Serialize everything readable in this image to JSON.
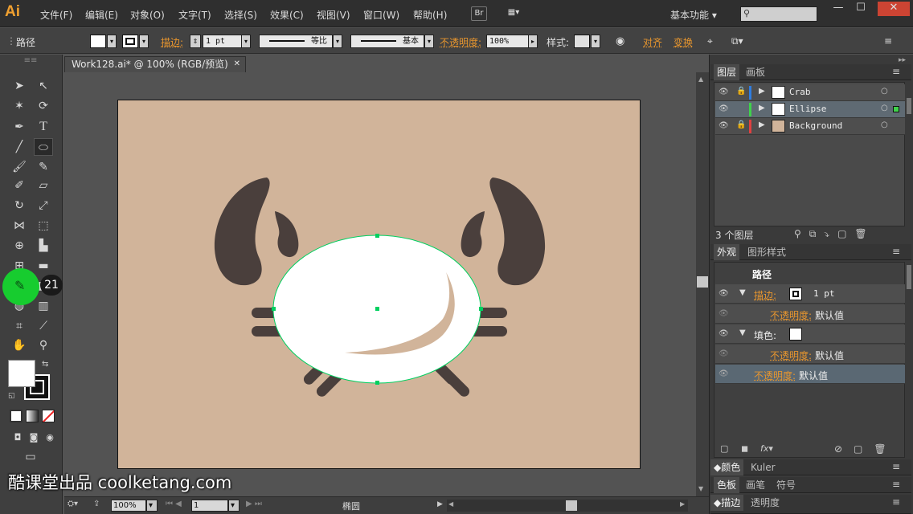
{
  "app": {
    "logo": "Ai",
    "menus": [
      "文件(F)",
      "编辑(E)",
      "对象(O)",
      "文字(T)",
      "选择(S)",
      "效果(C)",
      "视图(V)",
      "窗口(W)",
      "帮助(H)"
    ],
    "bridge_label": "Br",
    "workspace": "基本功能",
    "window_buttons": [
      "—",
      "☐",
      "✕"
    ]
  },
  "control_bar": {
    "object_type": "路径",
    "stroke_label": "描边:",
    "stroke_weight": "1 pt",
    "profile_label": "等比",
    "brush_label": "基本",
    "opacity_label": "不透明度:",
    "opacity_value": "100%",
    "style_label": "样式:",
    "align_label": "对齐",
    "transform_label": "变换"
  },
  "document": {
    "tab_title": "Work128.ai* @ 100% (RGB/预览)",
    "close": "✕"
  },
  "toolbox": {
    "badge": "21"
  },
  "status_bar": {
    "zoom": "100%",
    "artboard": "1",
    "current_tool": "椭圆"
  },
  "layers_panel": {
    "tabs": [
      "图层",
      "画板"
    ],
    "layers": [
      {
        "name": "Crab",
        "color": "#2f7de0"
      },
      {
        "name": "Ellipse",
        "color": "#3fd24b"
      },
      {
        "name": "Background",
        "color": "#e04040"
      }
    ],
    "count": "3 个图层"
  },
  "appearance_panel": {
    "tabs": [
      "外观",
      "图形样式"
    ],
    "title": "路径",
    "stroke_label": "描边:",
    "stroke_value": "1 pt",
    "stroke_opacity_label": "不透明度:",
    "stroke_opacity_value": "默认值",
    "fill_label": "填色:",
    "fill_opacity_label": "不透明度:",
    "fill_opacity_value": "默认值",
    "opacity_label": "不透明度:",
    "opacity_value": "默认值",
    "fx_label": "fx"
  },
  "collapsed_panels": [
    {
      "tabs": [
        "颜色",
        "Kuler"
      ]
    },
    {
      "tabs": [
        "色板",
        "画笔",
        "符号"
      ]
    },
    {
      "tabs": [
        "描边",
        "透明度"
      ]
    }
  ],
  "watermark": "酷课堂出品 coolketang.com",
  "colors": {
    "artboard": "#d1b49a",
    "crab_dark": "#4a3f3c",
    "ellipse_fill": "#ffffff",
    "selection": "#00d060",
    "accent_orange": "#e8962e"
  }
}
